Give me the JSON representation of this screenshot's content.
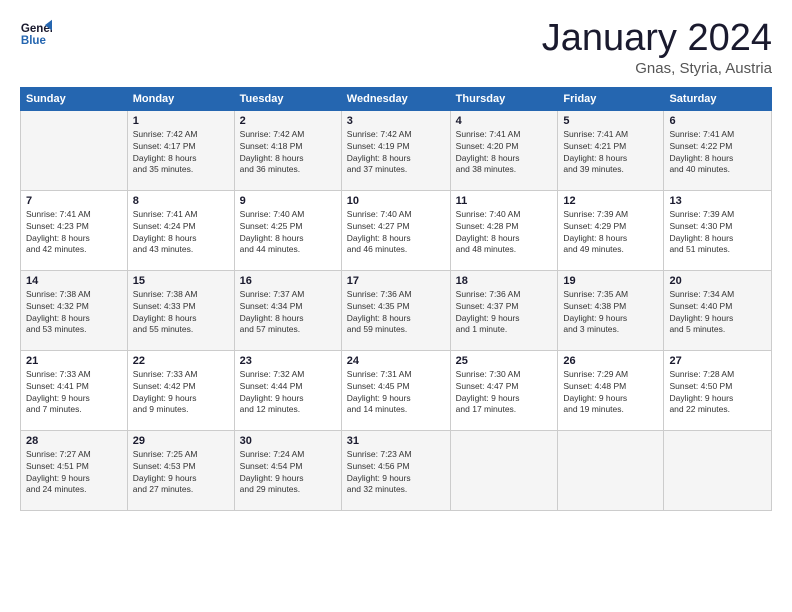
{
  "logo": {
    "line1": "General",
    "line2": "Blue"
  },
  "title": "January 2024",
  "subtitle": "Gnas, Styria, Austria",
  "days_header": [
    "Sunday",
    "Monday",
    "Tuesday",
    "Wednesday",
    "Thursday",
    "Friday",
    "Saturday"
  ],
  "weeks": [
    [
      {
        "num": "",
        "info": ""
      },
      {
        "num": "1",
        "info": "Sunrise: 7:42 AM\nSunset: 4:17 PM\nDaylight: 8 hours\nand 35 minutes."
      },
      {
        "num": "2",
        "info": "Sunrise: 7:42 AM\nSunset: 4:18 PM\nDaylight: 8 hours\nand 36 minutes."
      },
      {
        "num": "3",
        "info": "Sunrise: 7:42 AM\nSunset: 4:19 PM\nDaylight: 8 hours\nand 37 minutes."
      },
      {
        "num": "4",
        "info": "Sunrise: 7:41 AM\nSunset: 4:20 PM\nDaylight: 8 hours\nand 38 minutes."
      },
      {
        "num": "5",
        "info": "Sunrise: 7:41 AM\nSunset: 4:21 PM\nDaylight: 8 hours\nand 39 minutes."
      },
      {
        "num": "6",
        "info": "Sunrise: 7:41 AM\nSunset: 4:22 PM\nDaylight: 8 hours\nand 40 minutes."
      }
    ],
    [
      {
        "num": "7",
        "info": "Sunrise: 7:41 AM\nSunset: 4:23 PM\nDaylight: 8 hours\nand 42 minutes."
      },
      {
        "num": "8",
        "info": "Sunrise: 7:41 AM\nSunset: 4:24 PM\nDaylight: 8 hours\nand 43 minutes."
      },
      {
        "num": "9",
        "info": "Sunrise: 7:40 AM\nSunset: 4:25 PM\nDaylight: 8 hours\nand 44 minutes."
      },
      {
        "num": "10",
        "info": "Sunrise: 7:40 AM\nSunset: 4:27 PM\nDaylight: 8 hours\nand 46 minutes."
      },
      {
        "num": "11",
        "info": "Sunrise: 7:40 AM\nSunset: 4:28 PM\nDaylight: 8 hours\nand 48 minutes."
      },
      {
        "num": "12",
        "info": "Sunrise: 7:39 AM\nSunset: 4:29 PM\nDaylight: 8 hours\nand 49 minutes."
      },
      {
        "num": "13",
        "info": "Sunrise: 7:39 AM\nSunset: 4:30 PM\nDaylight: 8 hours\nand 51 minutes."
      }
    ],
    [
      {
        "num": "14",
        "info": "Sunrise: 7:38 AM\nSunset: 4:32 PM\nDaylight: 8 hours\nand 53 minutes."
      },
      {
        "num": "15",
        "info": "Sunrise: 7:38 AM\nSunset: 4:33 PM\nDaylight: 8 hours\nand 55 minutes."
      },
      {
        "num": "16",
        "info": "Sunrise: 7:37 AM\nSunset: 4:34 PM\nDaylight: 8 hours\nand 57 minutes."
      },
      {
        "num": "17",
        "info": "Sunrise: 7:36 AM\nSunset: 4:35 PM\nDaylight: 8 hours\nand 59 minutes."
      },
      {
        "num": "18",
        "info": "Sunrise: 7:36 AM\nSunset: 4:37 PM\nDaylight: 9 hours\nand 1 minute."
      },
      {
        "num": "19",
        "info": "Sunrise: 7:35 AM\nSunset: 4:38 PM\nDaylight: 9 hours\nand 3 minutes."
      },
      {
        "num": "20",
        "info": "Sunrise: 7:34 AM\nSunset: 4:40 PM\nDaylight: 9 hours\nand 5 minutes."
      }
    ],
    [
      {
        "num": "21",
        "info": "Sunrise: 7:33 AM\nSunset: 4:41 PM\nDaylight: 9 hours\nand 7 minutes."
      },
      {
        "num": "22",
        "info": "Sunrise: 7:33 AM\nSunset: 4:42 PM\nDaylight: 9 hours\nand 9 minutes."
      },
      {
        "num": "23",
        "info": "Sunrise: 7:32 AM\nSunset: 4:44 PM\nDaylight: 9 hours\nand 12 minutes."
      },
      {
        "num": "24",
        "info": "Sunrise: 7:31 AM\nSunset: 4:45 PM\nDaylight: 9 hours\nand 14 minutes."
      },
      {
        "num": "25",
        "info": "Sunrise: 7:30 AM\nSunset: 4:47 PM\nDaylight: 9 hours\nand 17 minutes."
      },
      {
        "num": "26",
        "info": "Sunrise: 7:29 AM\nSunset: 4:48 PM\nDaylight: 9 hours\nand 19 minutes."
      },
      {
        "num": "27",
        "info": "Sunrise: 7:28 AM\nSunset: 4:50 PM\nDaylight: 9 hours\nand 22 minutes."
      }
    ],
    [
      {
        "num": "28",
        "info": "Sunrise: 7:27 AM\nSunset: 4:51 PM\nDaylight: 9 hours\nand 24 minutes."
      },
      {
        "num": "29",
        "info": "Sunrise: 7:25 AM\nSunset: 4:53 PM\nDaylight: 9 hours\nand 27 minutes."
      },
      {
        "num": "30",
        "info": "Sunrise: 7:24 AM\nSunset: 4:54 PM\nDaylight: 9 hours\nand 29 minutes."
      },
      {
        "num": "31",
        "info": "Sunrise: 7:23 AM\nSunset: 4:56 PM\nDaylight: 9 hours\nand 32 minutes."
      },
      {
        "num": "",
        "info": ""
      },
      {
        "num": "",
        "info": ""
      },
      {
        "num": "",
        "info": ""
      }
    ]
  ]
}
